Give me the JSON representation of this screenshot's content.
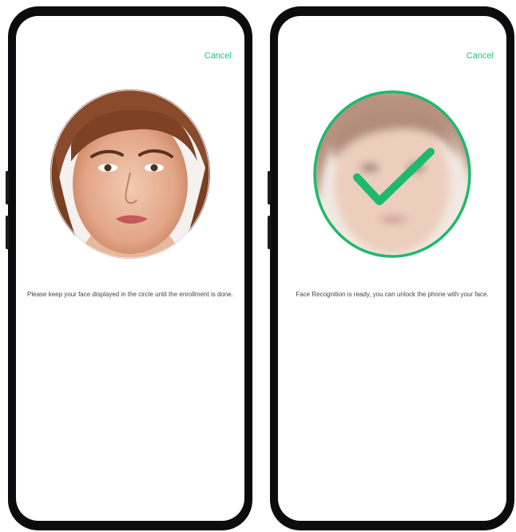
{
  "colors": {
    "accent": "#1ec27a",
    "phone_frame": "#0c0c0e",
    "screen_bg": "#ffffff",
    "check": "#1fb96d"
  },
  "left_screen": {
    "cancel_label": "Cancel",
    "instruction": "Please keep your face displayed in the circle until the enrollment is done."
  },
  "right_screen": {
    "cancel_label": "Cancel",
    "instruction": "Face Recognition is ready, you can unlock the phone with your face.",
    "status_icon": "checkmark-icon"
  }
}
